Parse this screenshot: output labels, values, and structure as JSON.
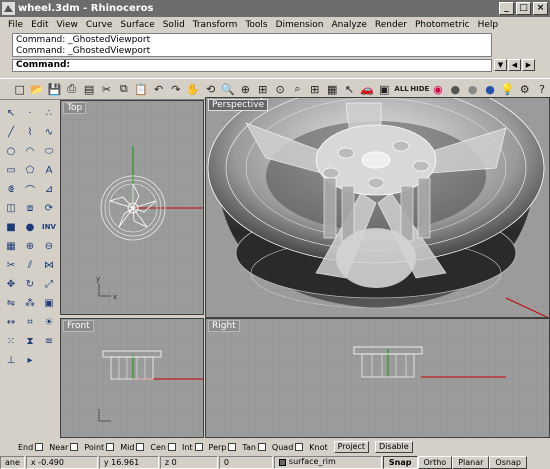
{
  "window": {
    "title": "wheel.3dm - Rhinoceros"
  },
  "menu": [
    "File",
    "Edit",
    "View",
    "Curve",
    "Surface",
    "Solid",
    "Transform",
    "Tools",
    "Dimension",
    "Analyze",
    "Render",
    "Photometric",
    "Help"
  ],
  "command": {
    "history": [
      "Command: _GhostedViewport",
      "Command: _GhostedViewport"
    ],
    "prompt": "Command:"
  },
  "toolbar": {
    "all_label": "ALL",
    "hide_label": "HIDE"
  },
  "lefttools": {
    "inv_label": "INV"
  },
  "viewports": {
    "top": "Top",
    "perspective": "Perspective",
    "front": "Front",
    "right": "Right"
  },
  "osnap": {
    "items": [
      "End",
      "Near",
      "Point",
      "Mid",
      "Cen",
      "Int",
      "Perp",
      "Tan",
      "Quad",
      "Knot"
    ],
    "project": "Project",
    "disable": "Disable"
  },
  "status": {
    "plane": "ane",
    "x": "x -0.490",
    "y": "y 16.961",
    "z": "z 0",
    "num": "0",
    "layer": "surface_rim",
    "snap": "Snap",
    "ortho": "Ortho",
    "planar": "Planar",
    "osnap": "Osnap"
  },
  "colors": {
    "axis_x": "#c00000",
    "axis_y": "#00a000",
    "viewport_bg": "#9c9c9c",
    "title_bg": "#6c6c6c"
  }
}
